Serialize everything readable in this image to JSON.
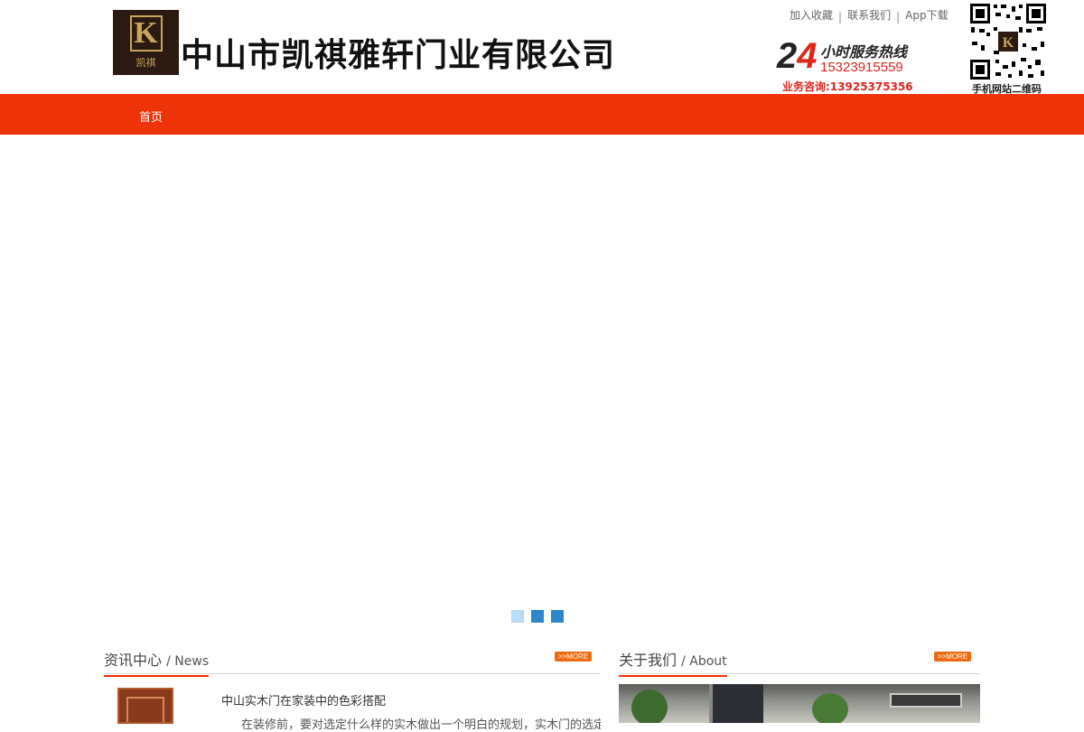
{
  "header": {
    "logo_name": "凯祺",
    "company_name": "中山市凯祺雅轩门业有限公司",
    "top_links": [
      "加入收藏",
      "联系我们",
      "App下载"
    ],
    "hotline": {
      "big": "24",
      "service_text": "小时服务热线",
      "phone": "15323915559",
      "consult": "业务咨询:13925375356"
    },
    "qr_caption": "手机网站二维码"
  },
  "nav": {
    "items": [
      "首页"
    ],
    "bg_color": "#ee3308"
  },
  "banner": {
    "slides_total": 3,
    "active_slide": 1
  },
  "news": {
    "title_cn": "资讯中心",
    "title_en": "/ News",
    "more": ">>MORE",
    "item_title": "中山实木门在家装中的色彩搭配",
    "item_summary": "在装修前，要对选定什么样的实木做出一个明白的规划，实木门的选定要与"
  },
  "about": {
    "title_cn": "关于我们",
    "title_en": "/ About",
    "more": ">>MORE"
  }
}
